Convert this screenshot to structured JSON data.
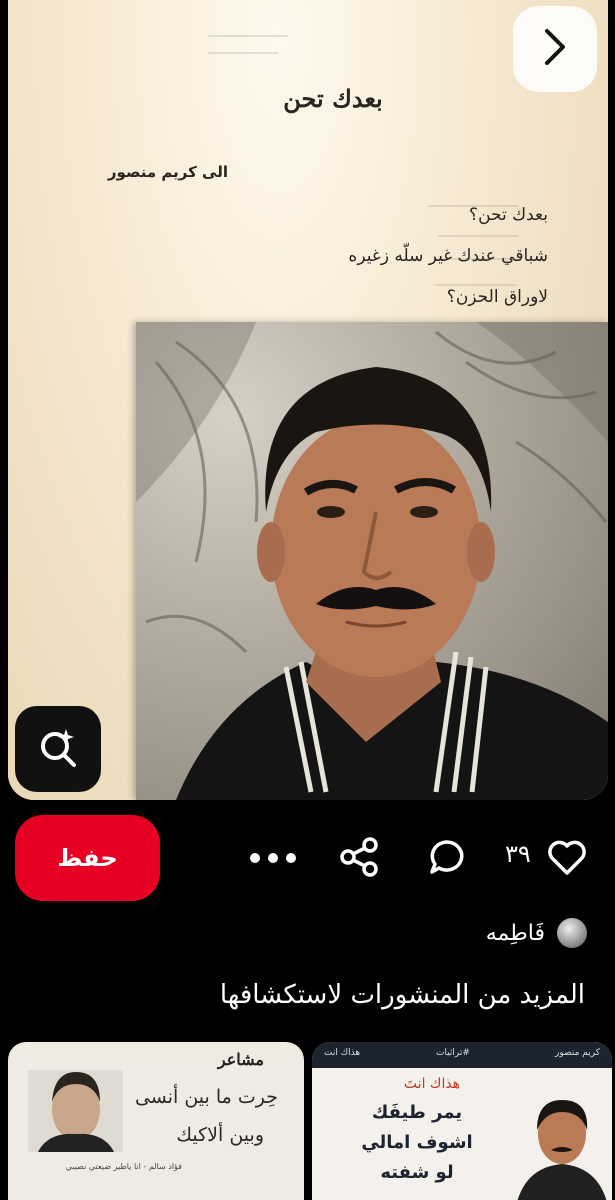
{
  "pin": {
    "poem": {
      "title": "بعدك تحن",
      "dedication": "الى كريم منصور",
      "lines": [
        "بعدك تحن؟",
        "شباقي عندك غير سلّه زغيره",
        "لاوراق الحزن؟"
      ]
    },
    "lens_icon": "visual-search-icon",
    "next_icon": "chevron-right-icon"
  },
  "actions": {
    "save_label": "حفظ",
    "like_count": "٣٩",
    "like_icon": "heart-icon",
    "comment_icon": "comment-icon",
    "share_icon": "share-icon",
    "more_icon": "more-dots-icon"
  },
  "author": {
    "name": "فَاطِمه"
  },
  "more_section": {
    "title": "المزيد من المنشورات لاستكشافها"
  },
  "cards": [
    {
      "header": "مشاعر",
      "verse1": "حِرت ما بين أنسى",
      "verse2": "وبين ألاكيك",
      "caption": "فؤاد سالم - انا ياطير ضيعتي نصيبي"
    },
    {
      "tag_left": "هذاك انت",
      "tag_mid": "#تراثيات",
      "tag_right": "كريم منصور",
      "title": "هذاك انتَ",
      "line1": "يمر طيفَك",
      "line2": "اشوف امالي",
      "line3": "لو شفته"
    }
  ],
  "colors": {
    "accent": "#e60023",
    "background": "#000000"
  }
}
